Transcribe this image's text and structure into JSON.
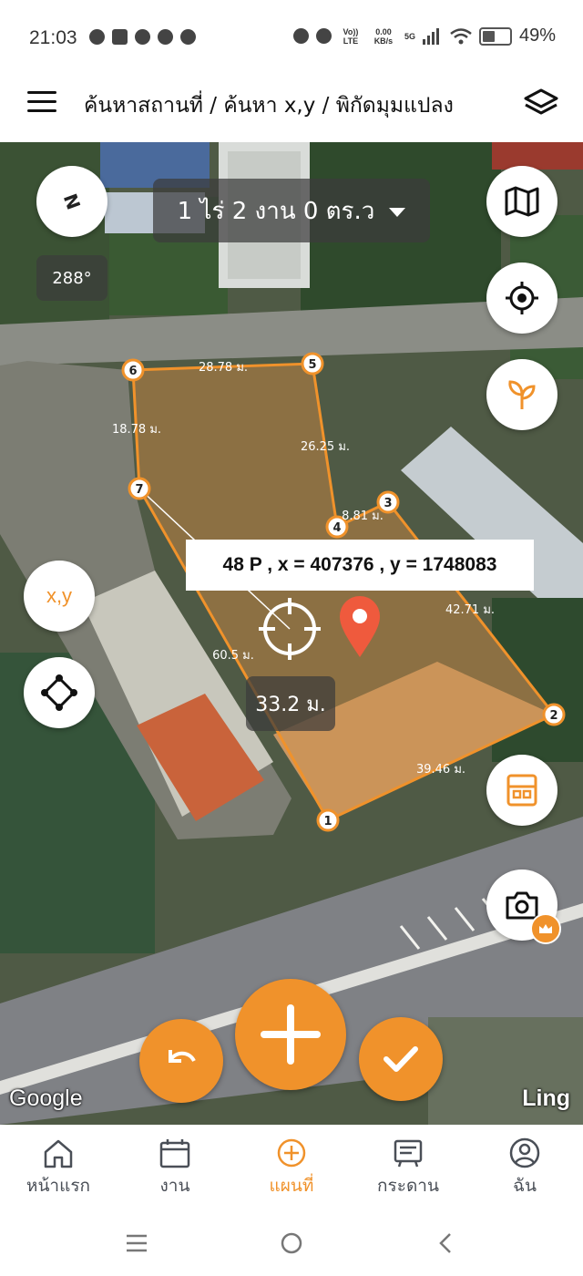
{
  "status_bar": {
    "time": "21:03",
    "net_type": "Vo)) LTE",
    "speed_value": "0.00",
    "speed_unit": "KB/s",
    "gen": "5G",
    "battery": "49%"
  },
  "app_bar": {
    "title": "ค้นหาสถานที่ / ค้นหา x,y / พิกัดมุมแปลง"
  },
  "map": {
    "area_label": "1 ไร่ 2 งาน 0 ตร.ว",
    "heading": "288°",
    "compass_label": "N",
    "coordinate_label": "48 P , x = 407376 , y = 1748083",
    "distance_label": "33.2 ม.",
    "xy_button_label": "x,y",
    "vertices": [
      "1",
      "2",
      "3",
      "4",
      "5",
      "6",
      "7"
    ],
    "edge_labels": {
      "e56": "28.78 ม.",
      "e67": "18.78 ม.",
      "e45": "26.25 ม.",
      "e34": "8.81 ม.",
      "e23": "42.71 ม.",
      "e12": "39.46 ม.",
      "e71": "60.5 ม."
    },
    "google_label": "Google",
    "brand_label": "Ling",
    "accent_color": "#f0922b"
  },
  "bottom_nav": {
    "items": [
      {
        "label": "หน้าแรก",
        "icon": "home-icon"
      },
      {
        "label": "งาน",
        "icon": "calendar-icon"
      },
      {
        "label": "แผนที่",
        "icon": "add-circle-icon",
        "active": true
      },
      {
        "label": "กระดาน",
        "icon": "board-icon"
      },
      {
        "label": "ฉัน",
        "icon": "user-icon"
      }
    ]
  }
}
